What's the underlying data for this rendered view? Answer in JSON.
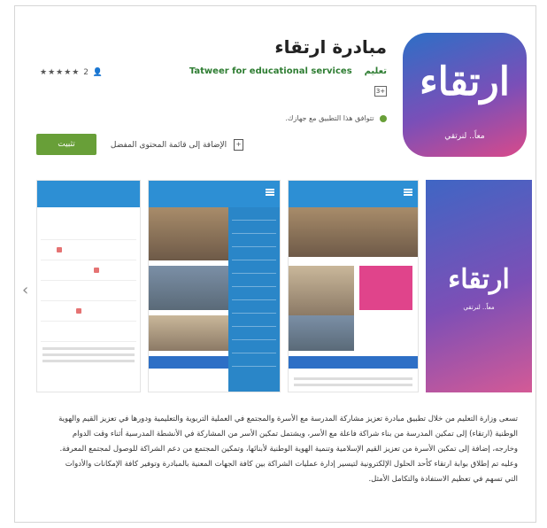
{
  "app": {
    "title": "مبادرة ارتقاء",
    "developer": "Tatweer for educational services",
    "developer_tag": "تعليم",
    "rating_text": "★★★★★ 2 👤",
    "content_badge": "3+",
    "compatibility": "تتوافق هذا التطبيق مع جهازك.",
    "wishlist_label": "الإضافة إلى قائمة المحتوى المفضل",
    "install_label": "تثبيت",
    "icon_glyph": "ارتقاء",
    "icon_sub": "معاً.. لنرتقي",
    "accent_color": "#689f38"
  },
  "gallery": {
    "prev_arrow": "‹",
    "shot1_glyph": "ارتقاء",
    "shot1_sub": "معاً.. لنرتقي"
  },
  "description": {
    "p1": "تسعى وزارة التعليم من خلال تطبيق مبادرة تعزيز مشاركة المدرسة مع الأسرة والمجتمع في العملية التربوية والتعليمية ودورها في تعزيز القيم والهوية الوطنية (ارتقاء) إلى تمكين المدرسة من بناء شراكة فاعلة مع الأسر، ويشتمل تمكين الأسر من المشاركة في الأنشطة المدرسية أثناء وقت الدوام وخارجه، إضافة إلى تمكين الأسرة من تعزيز القيم الإسلامية وتنمية الهوية الوطنية لأبنائها، وتمكين المجتمع من دعم الشراكة للوصول لمجتمع المعرفة.",
    "p2": "وعليه تم إطلاق بوابة ارتقاء كأحد الحلول الإلكترونية لتيسير إدارة عمليات الشراكة بين كافة الجهات المعنية بالمبادرة وتوفير كافة الإمكانات والأدوات التي تسهم في تعظيم الاستفادة والتكامل الأمثل."
  }
}
